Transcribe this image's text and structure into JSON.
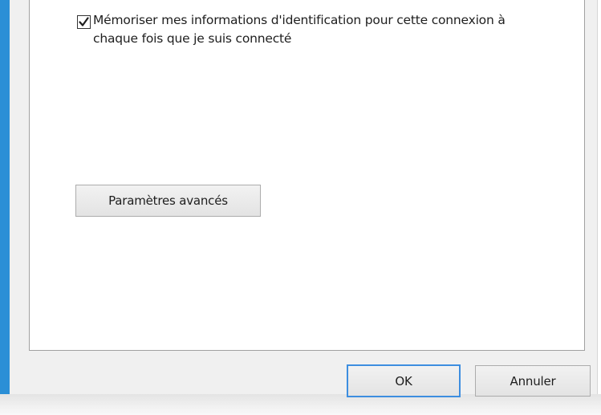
{
  "remember": {
    "checked": true,
    "label": "Mémoriser mes informations d'identification pour cette connexion à chaque fois que je suis connecté"
  },
  "buttons": {
    "advanced": "Paramètres avancés",
    "ok": "OK",
    "cancel": "Annuler"
  },
  "colors": {
    "window_frame": "#2b8fd6",
    "dialog_bg": "#f0f0f0",
    "focus_border": "#3d8ee0"
  }
}
